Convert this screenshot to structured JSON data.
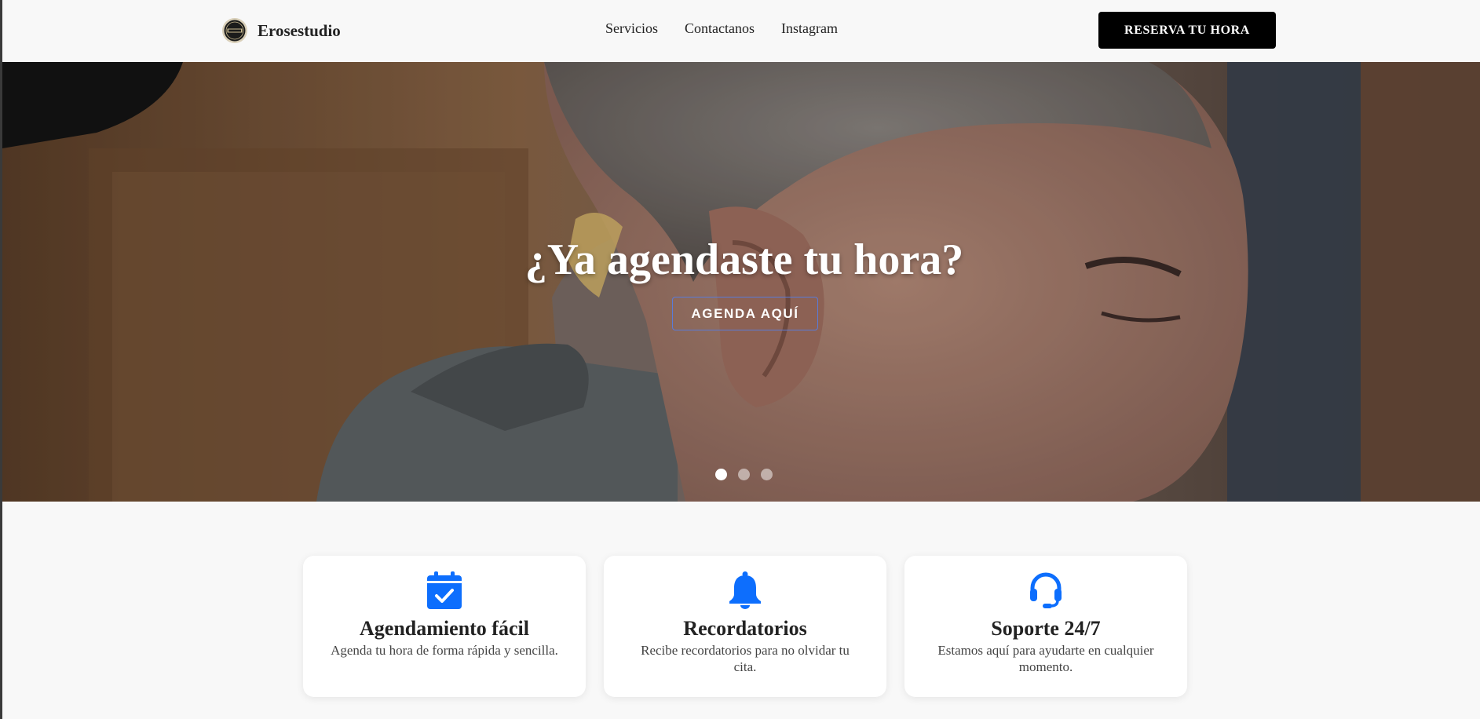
{
  "navbar": {
    "brand": {
      "name": "Erosestudio",
      "logo_icon": "brand-logo-icon"
    },
    "links": [
      {
        "label": "Servicios"
      },
      {
        "label": "Contactanos"
      },
      {
        "label": "Instagram"
      }
    ],
    "cta_label": "RESERVA TU HORA"
  },
  "hero": {
    "title": "¿Ya agendaste tu hora?",
    "button_label": "AGENDA AQUÍ",
    "slides": {
      "count": 3,
      "active": 1
    },
    "button_border_color": "#5a7bd8"
  },
  "features": [
    {
      "icon": "calendar-check-icon",
      "title": "Agendamiento fácil",
      "text": "Agenda tu hora de forma rápida y sencilla."
    },
    {
      "icon": "bell-icon",
      "title": "Recordatorios",
      "text": "Recibe recordatorios para no olvidar tu cita."
    },
    {
      "icon": "headset-icon",
      "title": "Soporte 24/7",
      "text": "Estamos aquí para ayudarte en cualquier momento."
    }
  ],
  "colors": {
    "accent": "#0d6efd",
    "navbar_bg": "#f8f8f8",
    "cta_bg": "#000000",
    "cta_text": "#ffffff"
  }
}
